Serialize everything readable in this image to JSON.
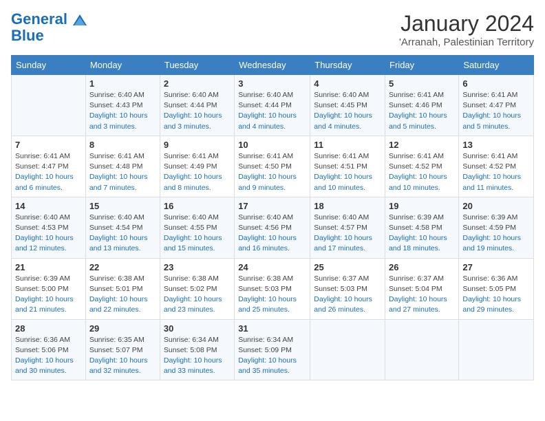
{
  "logo": {
    "line1": "General",
    "line2": "Blue"
  },
  "title": "January 2024",
  "subtitle": "'Arranah, Palestinian Territory",
  "days_header": [
    "Sunday",
    "Monday",
    "Tuesday",
    "Wednesday",
    "Thursday",
    "Friday",
    "Saturday"
  ],
  "weeks": [
    [
      {
        "num": "",
        "sunrise": "",
        "sunset": "",
        "daylight": ""
      },
      {
        "num": "1",
        "sunrise": "Sunrise: 6:40 AM",
        "sunset": "Sunset: 4:43 PM",
        "daylight": "Daylight: 10 hours and 3 minutes."
      },
      {
        "num": "2",
        "sunrise": "Sunrise: 6:40 AM",
        "sunset": "Sunset: 4:44 PM",
        "daylight": "Daylight: 10 hours and 3 minutes."
      },
      {
        "num": "3",
        "sunrise": "Sunrise: 6:40 AM",
        "sunset": "Sunset: 4:44 PM",
        "daylight": "Daylight: 10 hours and 4 minutes."
      },
      {
        "num": "4",
        "sunrise": "Sunrise: 6:40 AM",
        "sunset": "Sunset: 4:45 PM",
        "daylight": "Daylight: 10 hours and 4 minutes."
      },
      {
        "num": "5",
        "sunrise": "Sunrise: 6:41 AM",
        "sunset": "Sunset: 4:46 PM",
        "daylight": "Daylight: 10 hours and 5 minutes."
      },
      {
        "num": "6",
        "sunrise": "Sunrise: 6:41 AM",
        "sunset": "Sunset: 4:47 PM",
        "daylight": "Daylight: 10 hours and 5 minutes."
      }
    ],
    [
      {
        "num": "7",
        "sunrise": "Sunrise: 6:41 AM",
        "sunset": "Sunset: 4:47 PM",
        "daylight": "Daylight: 10 hours and 6 minutes."
      },
      {
        "num": "8",
        "sunrise": "Sunrise: 6:41 AM",
        "sunset": "Sunset: 4:48 PM",
        "daylight": "Daylight: 10 hours and 7 minutes."
      },
      {
        "num": "9",
        "sunrise": "Sunrise: 6:41 AM",
        "sunset": "Sunset: 4:49 PM",
        "daylight": "Daylight: 10 hours and 8 minutes."
      },
      {
        "num": "10",
        "sunrise": "Sunrise: 6:41 AM",
        "sunset": "Sunset: 4:50 PM",
        "daylight": "Daylight: 10 hours and 9 minutes."
      },
      {
        "num": "11",
        "sunrise": "Sunrise: 6:41 AM",
        "sunset": "Sunset: 4:51 PM",
        "daylight": "Daylight: 10 hours and 10 minutes."
      },
      {
        "num": "12",
        "sunrise": "Sunrise: 6:41 AM",
        "sunset": "Sunset: 4:52 PM",
        "daylight": "Daylight: 10 hours and 10 minutes."
      },
      {
        "num": "13",
        "sunrise": "Sunrise: 6:41 AM",
        "sunset": "Sunset: 4:52 PM",
        "daylight": "Daylight: 10 hours and 11 minutes."
      }
    ],
    [
      {
        "num": "14",
        "sunrise": "Sunrise: 6:40 AM",
        "sunset": "Sunset: 4:53 PM",
        "daylight": "Daylight: 10 hours and 12 minutes."
      },
      {
        "num": "15",
        "sunrise": "Sunrise: 6:40 AM",
        "sunset": "Sunset: 4:54 PM",
        "daylight": "Daylight: 10 hours and 13 minutes."
      },
      {
        "num": "16",
        "sunrise": "Sunrise: 6:40 AM",
        "sunset": "Sunset: 4:55 PM",
        "daylight": "Daylight: 10 hours and 15 minutes."
      },
      {
        "num": "17",
        "sunrise": "Sunrise: 6:40 AM",
        "sunset": "Sunset: 4:56 PM",
        "daylight": "Daylight: 10 hours and 16 minutes."
      },
      {
        "num": "18",
        "sunrise": "Sunrise: 6:40 AM",
        "sunset": "Sunset: 4:57 PM",
        "daylight": "Daylight: 10 hours and 17 minutes."
      },
      {
        "num": "19",
        "sunrise": "Sunrise: 6:39 AM",
        "sunset": "Sunset: 4:58 PM",
        "daylight": "Daylight: 10 hours and 18 minutes."
      },
      {
        "num": "20",
        "sunrise": "Sunrise: 6:39 AM",
        "sunset": "Sunset: 4:59 PM",
        "daylight": "Daylight: 10 hours and 19 minutes."
      }
    ],
    [
      {
        "num": "21",
        "sunrise": "Sunrise: 6:39 AM",
        "sunset": "Sunset: 5:00 PM",
        "daylight": "Daylight: 10 hours and 21 minutes."
      },
      {
        "num": "22",
        "sunrise": "Sunrise: 6:38 AM",
        "sunset": "Sunset: 5:01 PM",
        "daylight": "Daylight: 10 hours and 22 minutes."
      },
      {
        "num": "23",
        "sunrise": "Sunrise: 6:38 AM",
        "sunset": "Sunset: 5:02 PM",
        "daylight": "Daylight: 10 hours and 23 minutes."
      },
      {
        "num": "24",
        "sunrise": "Sunrise: 6:38 AM",
        "sunset": "Sunset: 5:03 PM",
        "daylight": "Daylight: 10 hours and 25 minutes."
      },
      {
        "num": "25",
        "sunrise": "Sunrise: 6:37 AM",
        "sunset": "Sunset: 5:03 PM",
        "daylight": "Daylight: 10 hours and 26 minutes."
      },
      {
        "num": "26",
        "sunrise": "Sunrise: 6:37 AM",
        "sunset": "Sunset: 5:04 PM",
        "daylight": "Daylight: 10 hours and 27 minutes."
      },
      {
        "num": "27",
        "sunrise": "Sunrise: 6:36 AM",
        "sunset": "Sunset: 5:05 PM",
        "daylight": "Daylight: 10 hours and 29 minutes."
      }
    ],
    [
      {
        "num": "28",
        "sunrise": "Sunrise: 6:36 AM",
        "sunset": "Sunset: 5:06 PM",
        "daylight": "Daylight: 10 hours and 30 minutes."
      },
      {
        "num": "29",
        "sunrise": "Sunrise: 6:35 AM",
        "sunset": "Sunset: 5:07 PM",
        "daylight": "Daylight: 10 hours and 32 minutes."
      },
      {
        "num": "30",
        "sunrise": "Sunrise: 6:34 AM",
        "sunset": "Sunset: 5:08 PM",
        "daylight": "Daylight: 10 hours and 33 minutes."
      },
      {
        "num": "31",
        "sunrise": "Sunrise: 6:34 AM",
        "sunset": "Sunset: 5:09 PM",
        "daylight": "Daylight: 10 hours and 35 minutes."
      },
      {
        "num": "",
        "sunrise": "",
        "sunset": "",
        "daylight": ""
      },
      {
        "num": "",
        "sunrise": "",
        "sunset": "",
        "daylight": ""
      },
      {
        "num": "",
        "sunrise": "",
        "sunset": "",
        "daylight": ""
      }
    ]
  ]
}
